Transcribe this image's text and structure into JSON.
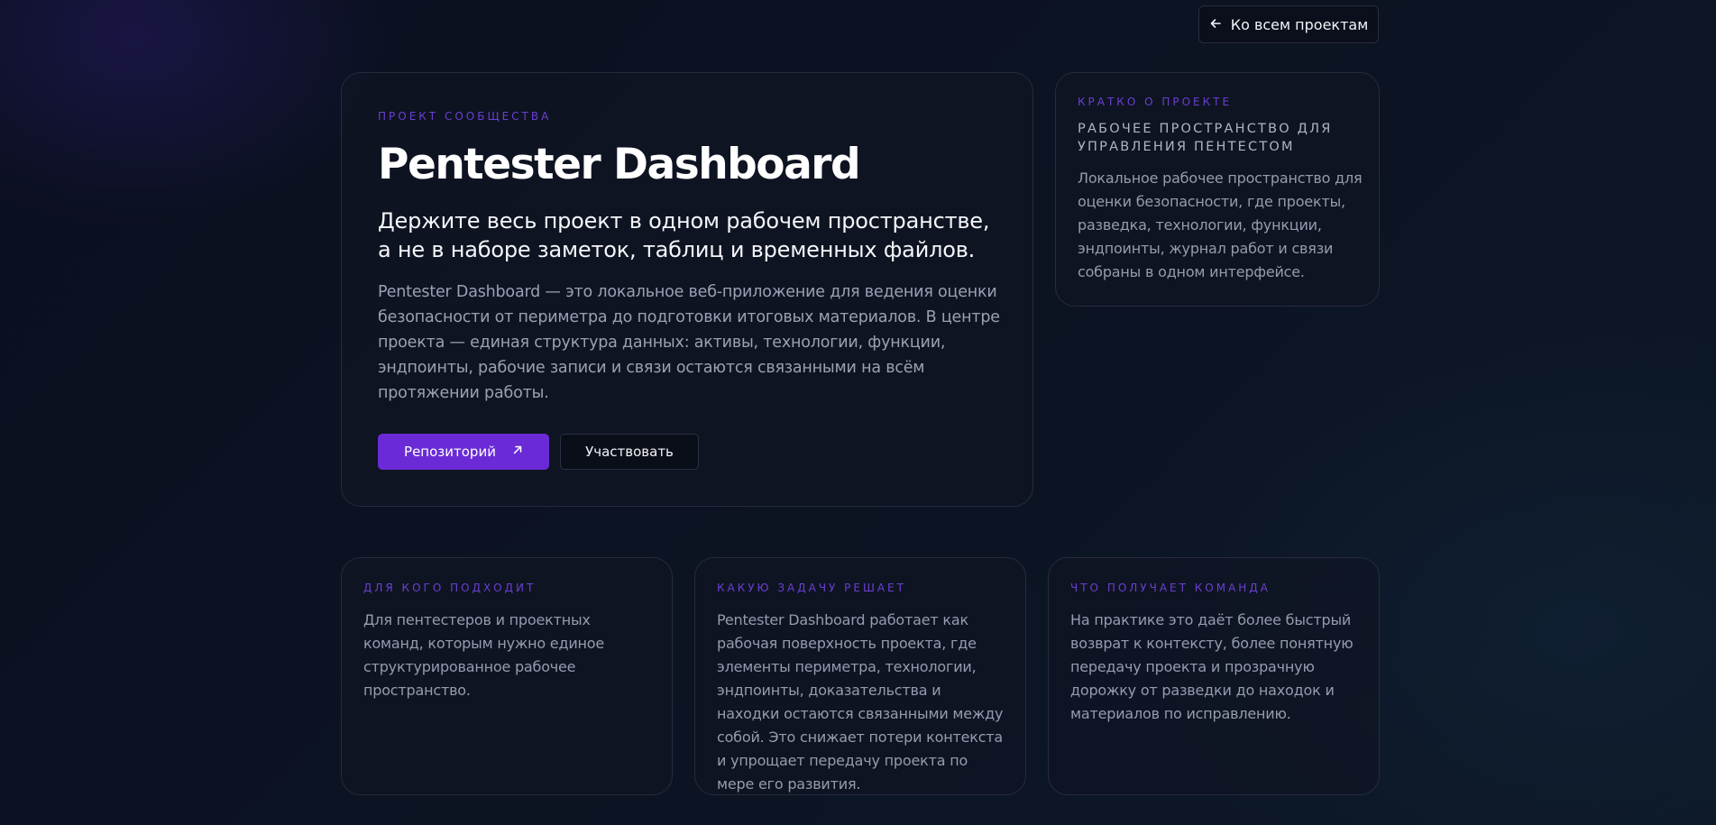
{
  "nav": {
    "back_label": "Ко всем проектам"
  },
  "hero": {
    "eyebrow": "ПРОЕКТ СООБЩЕСТВА",
    "title": "Pentester Dashboard",
    "subtitle": "Держите весь проект в одном рабочем пространстве, а не в наборе заметок, таблиц и временных файлов.",
    "description": "Pentester Dashboard — это локальное веб-приложение для ведения оценки безопасности от периметра до подготовки итоговых материалов. В центре проекта — единая структура данных: активы, технологии, функции, эндпоинты, рабочие записи и связи остаются связанными на всём протяжении работы.",
    "primary_button": "Репозиторий",
    "secondary_button": "Участвовать"
  },
  "summary": {
    "eyebrow": "КРАТКО О ПРОЕКТЕ",
    "heading": "РАБОЧЕЕ ПРОСТРАНСТВО ДЛЯ УПРАВЛЕНИЯ ПЕНТЕСТОМ",
    "text": "Локальное рабочее пространство для оценки безопасности, где проекты, разведка, технологии, функции, эндпоинты, журнал работ и связи собраны в одном интерфейсе."
  },
  "info_cards": [
    {
      "eyebrow": "ДЛЯ КОГО ПОДХОДИТ",
      "text": "Для пентестеров и проектных команд, которым нужно единое структурированное рабочее пространство."
    },
    {
      "eyebrow": "КАКУЮ ЗАДАЧУ РЕШАЕТ",
      "text": "Pentester Dashboard работает как рабочая поверхность проекта, где элементы периметра, технологии, эндпоинты, доказательства и находки остаются связанными между собой. Это снижает потери контекста и упрощает передачу проекта по мере его развития."
    },
    {
      "eyebrow": "ЧТО ПОЛУЧАЕТ КОМАНДА",
      "text": "На практике это даёт более быстрый возврат к контексту, более понятную передачу проекта и прозрачную дорожку от разведки до находок и материалов по исправлению."
    }
  ],
  "colors": {
    "accent": "#6a2bd6",
    "eyebrow": "#6a3fd1",
    "background": "#0c1322"
  },
  "icons": {
    "back": "arrow-left-icon",
    "external": "arrow-up-right-icon"
  }
}
